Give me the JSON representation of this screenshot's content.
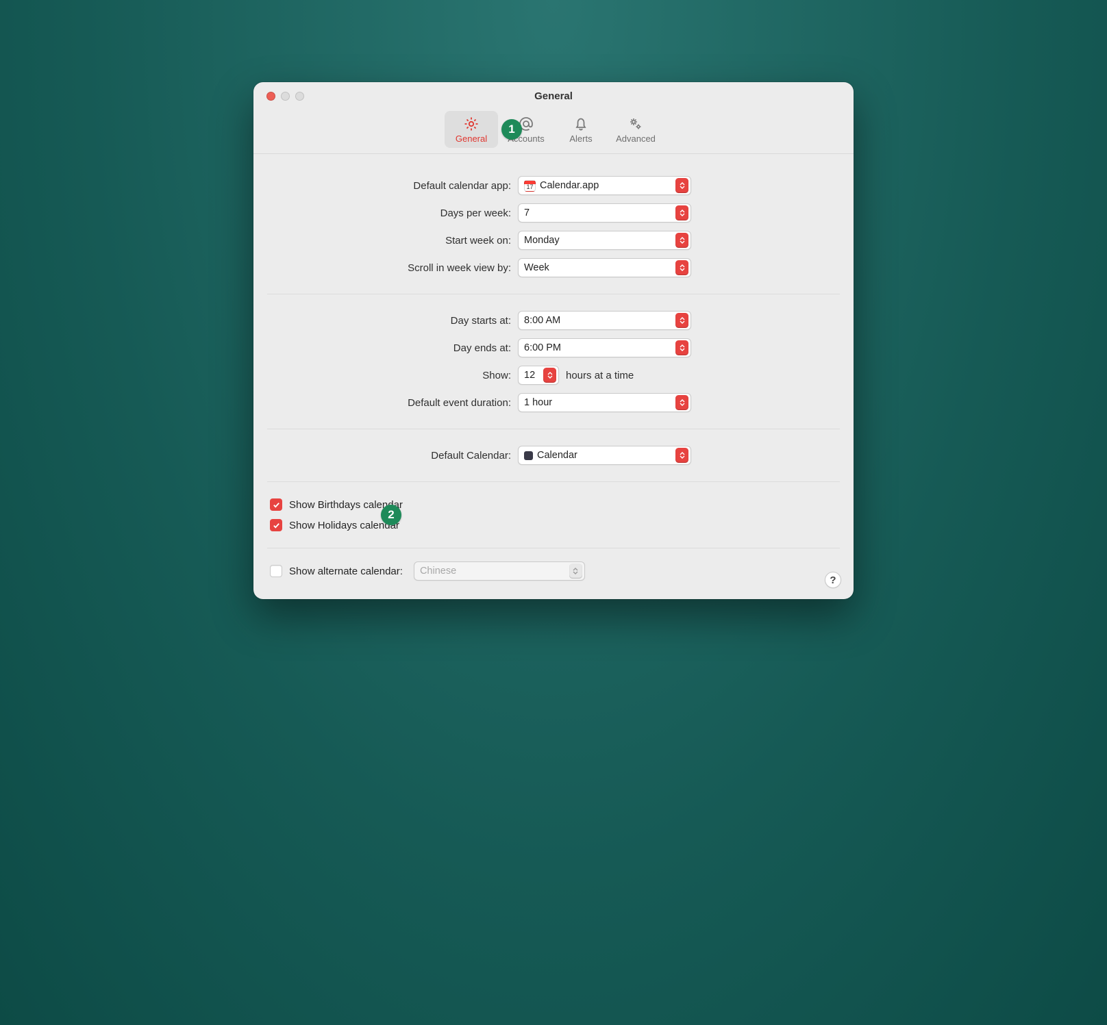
{
  "window": {
    "title": "General"
  },
  "badges": {
    "b1": "1",
    "b2": "2"
  },
  "tabs": {
    "general": "General",
    "accounts": "Accounts",
    "alerts": "Alerts",
    "advanced": "Advanced"
  },
  "section1": {
    "default_calendar_app": {
      "label": "Default calendar app:",
      "value": "Calendar.app"
    },
    "days_per_week": {
      "label": "Days per week:",
      "value": "7"
    },
    "start_week_on": {
      "label": "Start week on:",
      "value": "Monday"
    },
    "scroll_in_week_view_by": {
      "label": "Scroll in week view by:",
      "value": "Week"
    }
  },
  "section2": {
    "day_starts_at": {
      "label": "Day starts at:",
      "value": "8:00 AM"
    },
    "day_ends_at": {
      "label": "Day ends at:",
      "value": "6:00 PM"
    },
    "show": {
      "label": "Show:",
      "value": "12",
      "suffix": "hours at a time"
    },
    "default_event_duration": {
      "label": "Default event duration:",
      "value": "1 hour"
    }
  },
  "section3": {
    "default_calendar": {
      "label": "Default Calendar:",
      "value": "Calendar"
    }
  },
  "section4": {
    "show_birthdays": {
      "label": "Show Birthdays calendar",
      "checked": true
    },
    "show_holidays": {
      "label": "Show Holidays calendar",
      "checked": true
    }
  },
  "section5": {
    "show_alternate": {
      "label": "Show alternate calendar:",
      "checked": false,
      "value": "Chinese"
    }
  },
  "help": "?",
  "calicon_day": "17"
}
